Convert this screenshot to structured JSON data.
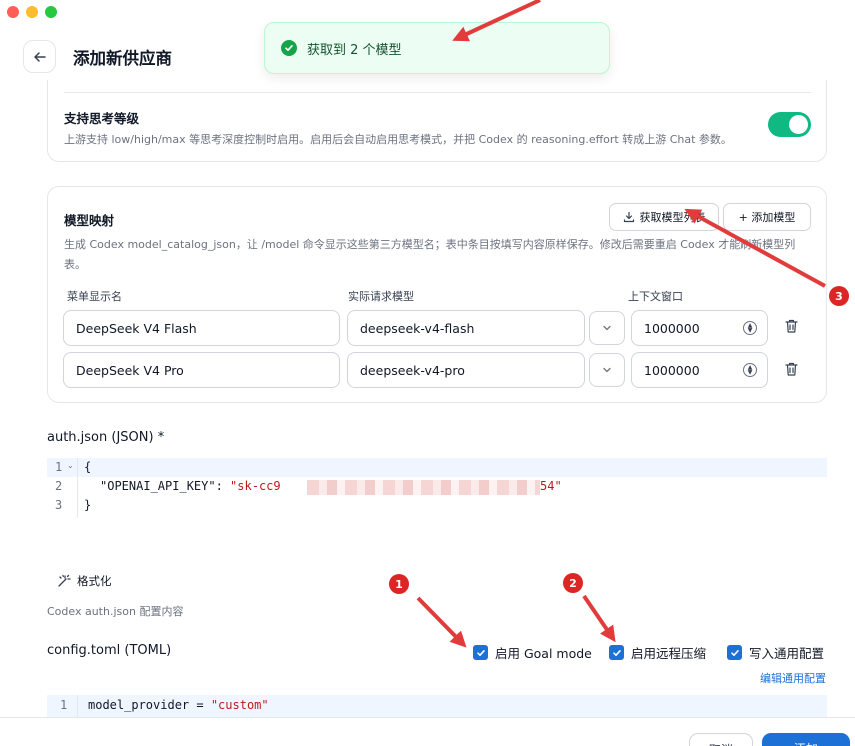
{
  "header": {
    "title": "添加新供应商"
  },
  "toast": {
    "message": "获取到 2 个模型"
  },
  "thinking": {
    "title": "支持思考等级",
    "description": "上游支持 low/high/max 等思考深度控制时启用。启用后会自动启用思考模式，并把 Codex 的 reasoning.effort 转成上游 Chat 参数。",
    "enabled": true
  },
  "mapping": {
    "title": "模型映射",
    "fetch_label": "获取模型列表",
    "add_label": "+ 添加模型",
    "desc_line1": "生成 Codex model_catalog_json，让 /model 命令显示这些第三方模型名；表中条目按填写内容原样保存。修改后需要重启 Codex 才能刷新模型列",
    "desc_line2": "表。",
    "columns": {
      "display": "菜单显示名",
      "request": "实际请求模型",
      "context": "上下文窗口"
    },
    "rows": [
      {
        "display": "DeepSeek V4 Flash",
        "request": "deepseek-v4-flash",
        "context": "1000000"
      },
      {
        "display": "DeepSeek V4 Pro",
        "request": "deepseek-v4-pro",
        "context": "1000000"
      }
    ]
  },
  "auth": {
    "label": "auth.json (JSON) *",
    "lines": {
      "n1": "1",
      "n2": "2",
      "n3": "3",
      "l1": "{",
      "key": "\"OPENAI_API_KEY\"",
      "colon": ": ",
      "val_start": "\"sk-cc9",
      "val_end": "54\"",
      "l3": "}"
    },
    "format_label": "格式化",
    "hint": "Codex auth.json 配置内容"
  },
  "config": {
    "label": "config.toml (TOML)",
    "options": [
      {
        "label": "启用 Goal mode",
        "checked": true
      },
      {
        "label": "启用远程压缩",
        "checked": true
      },
      {
        "label": "写入通用配置",
        "checked": true
      }
    ],
    "edit_common": "编辑通用配置",
    "line_no": "1",
    "line_key": "model_provider = ",
    "line_val": "\"custom\""
  },
  "annotations": {
    "b1": "1",
    "b2": "2",
    "b3": "3"
  },
  "footer": {
    "cancel": "取消",
    "submit": "添加"
  },
  "colors": {
    "accent": "#1d70d6",
    "toggle": "#10b981",
    "success": "#16a34a",
    "annotation": "#dc2626"
  }
}
